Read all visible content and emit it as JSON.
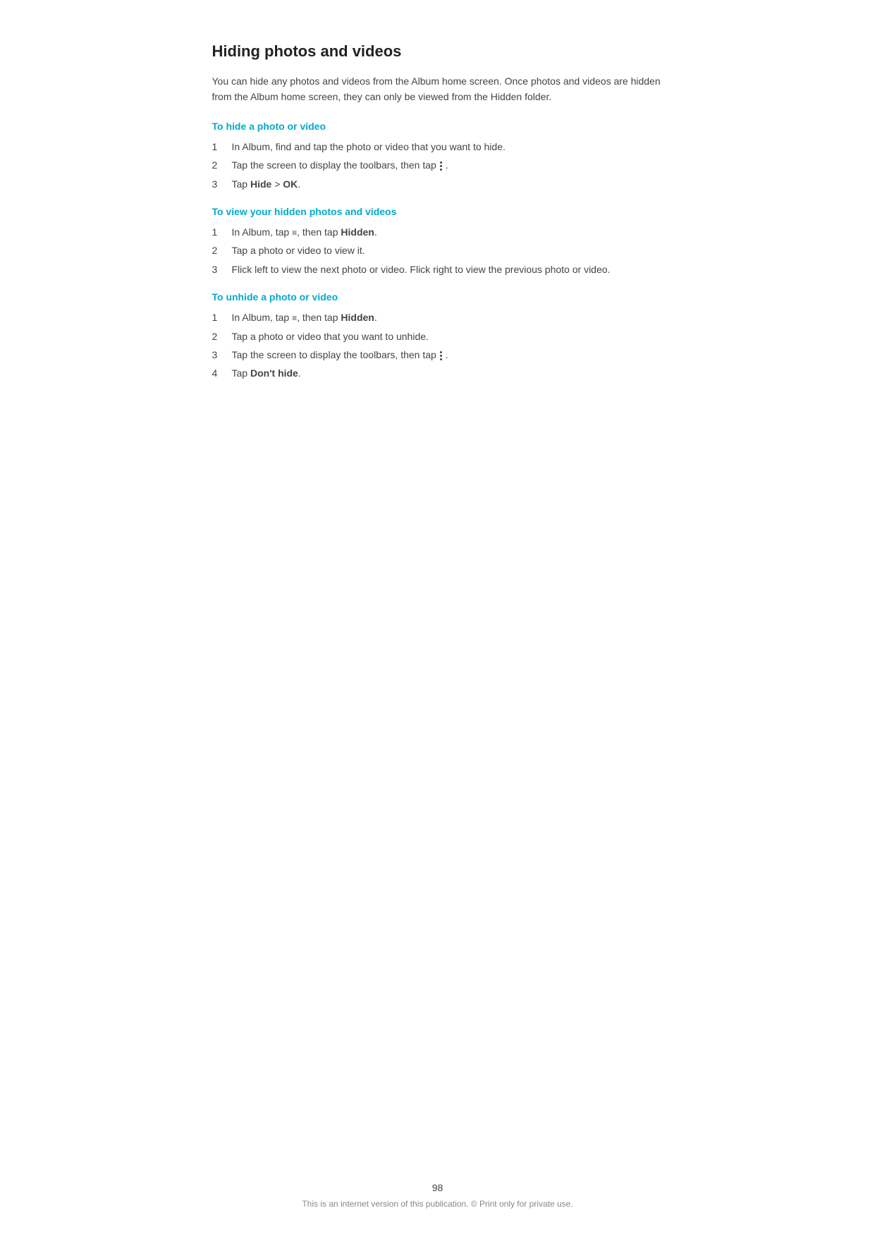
{
  "page": {
    "title": "Hiding photos and videos",
    "intro": "You can hide any photos and videos from the Album home screen. Once photos and videos are hidden from the Album home screen, they can only be viewed from the Hidden folder.",
    "sections": [
      {
        "heading": "To hide a photo or video",
        "steps": [
          {
            "number": "1",
            "text": "In Album, find and tap the photo or video that you want to hide."
          },
          {
            "number": "2",
            "text": "Tap the screen to display the toolbars, then tap",
            "icon": "more",
            "suffix": "."
          },
          {
            "number": "3",
            "text": "Tap ",
            "bold1": "Hide",
            "mid": " > ",
            "bold2": "OK",
            "suffix": "."
          }
        ]
      },
      {
        "heading": "To view your hidden photos and videos",
        "steps": [
          {
            "number": "1",
            "text": "In Album, tap",
            "icon": "menu",
            "suffix": ", then tap ",
            "bold1": "Hidden",
            "end": "."
          },
          {
            "number": "2",
            "text": "Tap a photo or video to view it."
          },
          {
            "number": "3",
            "text": "Flick left to view the next photo or video. Flick right to view the previous photo or video."
          }
        ]
      },
      {
        "heading": "To unhide a photo or video",
        "steps": [
          {
            "number": "1",
            "text": "In Album, tap",
            "icon": "menu",
            "suffix": ", then tap ",
            "bold1": "Hidden",
            "end": "."
          },
          {
            "number": "2",
            "text": "Tap a photo or video that you want to unhide."
          },
          {
            "number": "3",
            "text": "Tap the screen to display the toolbars, then tap",
            "icon": "more",
            "suffix": "."
          },
          {
            "number": "4",
            "text": "Tap ",
            "bold1": "Don't hide",
            "end": "."
          }
        ]
      }
    ],
    "page_number": "98",
    "footer_text": "This is an internet version of this publication. © Print only for private use."
  }
}
